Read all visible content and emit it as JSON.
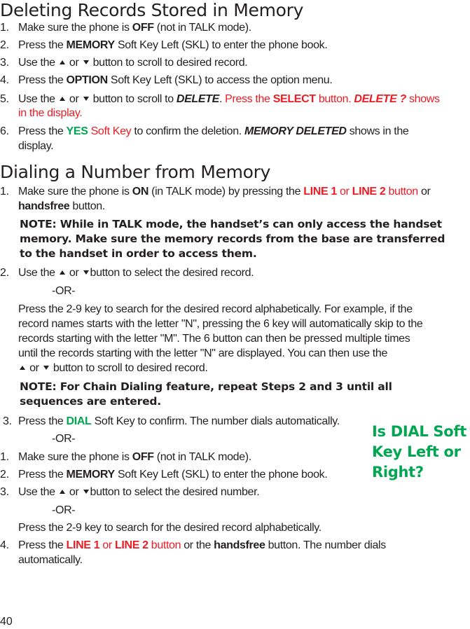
{
  "sections": {
    "deleting": {
      "title": "Deleting Records Stored in Memory",
      "steps": [
        {
          "num": "1.",
          "pre": "Make sure the phone is ",
          "bold": "OFF",
          "post": " (not in TALK mode)."
        },
        {
          "num": "2.",
          "pre": "Press the ",
          "bold": "MEMORY",
          "post": " Soft Key Left (SKL) to enter the phone book."
        },
        {
          "num": "3.",
          "pre": "Use the ",
          "or": " or ",
          "post": " button to scroll to desired record."
        },
        {
          "num": "4.",
          "pre": "Press the ",
          "bold": "OPTION",
          "post": " Soft Key Left (SKL) to access the option menu."
        },
        {
          "num": "5.",
          "pre": "Use the ",
          "or": " or ",
          "mid": " button to scroll to ",
          "bi": "DELETE",
          "dot": ". ",
          "red1": "Press the ",
          "red_bold": "SELECT",
          "red2": " button. ",
          "red_bi": "DELETE ?",
          "red3": " shows",
          "red4": "in the display."
        },
        {
          "num": "6.",
          "pre": "Press the ",
          "green_bold": "YES",
          "red": " Soft Key",
          "mid": " to confirm the deletion. ",
          "bi": "MEMORY DELETED",
          "post": " shows in the",
          "post2": "display."
        }
      ]
    },
    "dialing": {
      "title": "Dialing a Number from Memory",
      "step1": {
        "num": "1.",
        "pre": "Make sure the phone is ",
        "bold": "ON",
        "mid": " (in TALK mode) by pressing the ",
        "red_b1": "LINE 1",
        "red_or": " or ",
        "red_b2": "LINE 2",
        "red_btn": " button",
        "post": " or",
        "bold2": "handsfree",
        "post2": " button."
      },
      "note1": [
        "NOTE: While in TALK mode, the handset’s can only access the handset",
        "memory. Make sure the memory records from the base are transferred",
        "to the handset in order to access them."
      ],
      "step2": {
        "num": "2.",
        "pre": "Use the ",
        "or": " or ",
        "post": "button to select the desired record."
      },
      "or_label": "-OR-",
      "para": [
        "Press the 2-9 key to search for the desired record alphabetically. For example, if the",
        "record names starts with the letter \"N\", pressing the 6 key will automatically skip to the",
        "records starting with the letter \"M\". The 6 button can then be pressed multiple times",
        "until the records starting with the letter \"N\" are displayed. You can then use the"
      ],
      "para_last": {
        "or": " or ",
        "post": " button to scroll to desired record."
      },
      "note2": [
        "NOTE: For Chain Dialing feature, repeat Steps 2 and 3 until all",
        "sequences are entered."
      ],
      "step3": {
        "num": "3.",
        "pre": "Press the ",
        "green_bold": "DIAL",
        "post": " Soft Key to confirm. The number dials automatically."
      },
      "alt": [
        {
          "num": "1.",
          "pre": "Make sure the phone is ",
          "bold": "OFF",
          "post": " (not in TALK mode)."
        },
        {
          "num": "2.",
          "pre": "Press the ",
          "bold": "MEMORY",
          "post": " Soft Key Left (SKL) to enter the phone book."
        },
        {
          "num": "3.",
          "pre": "Use the ",
          "or": " or ",
          "post": "button to select the desired number."
        }
      ],
      "alt_para": "Press the 2-9 key to search for the desired record alphabetically.",
      "step4": {
        "num": "4.",
        "pre": "Press the ",
        "red_b1": "LINE 1",
        "red_or": " or ",
        "red_b2": "LINE 2",
        "red_btn": " button",
        "mid": " or the ",
        "bold": "handsfree",
        "post": " button. The number dials",
        "post2": "automatically."
      }
    }
  },
  "comment": "Is DIAL Soft Key Left or Right?",
  "page_number": "40",
  "colors": {
    "text": "#231f20",
    "red": "#ed1c24",
    "green": "#00a651"
  }
}
